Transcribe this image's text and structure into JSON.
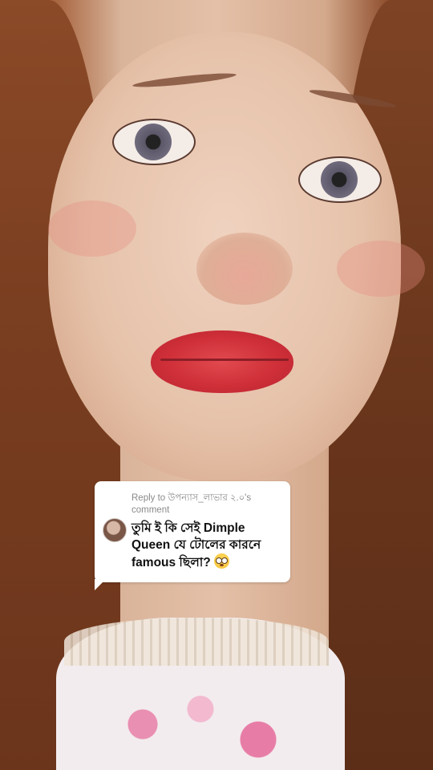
{
  "reply_card": {
    "reply_label": "Reply to উপন্যাস_লাভার ২.০'s comment",
    "comment": "তুমি ই কি সেই Dimple Queen যে টোলের কারনে famous ছিলা?",
    "emoji": "flushed-face"
  }
}
